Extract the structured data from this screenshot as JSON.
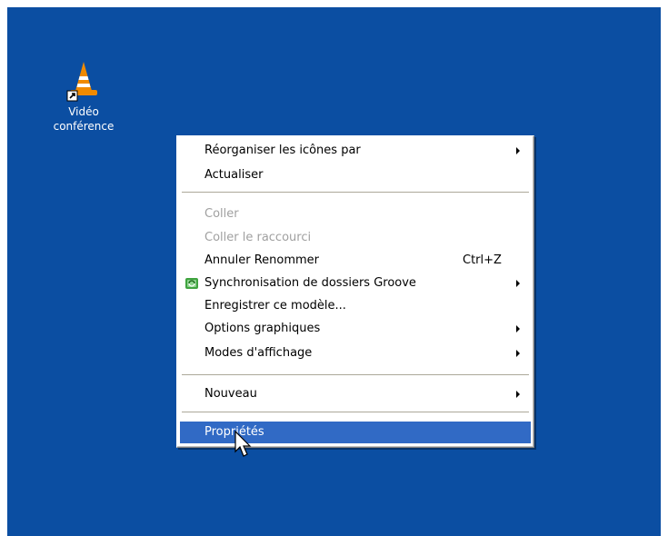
{
  "desktop": {
    "background": "#0b4ea2",
    "icon": {
      "name": "vlc-cone-icon",
      "label_line1": "Vidéo",
      "label_line2": "conférence"
    }
  },
  "context_menu": {
    "items": [
      {
        "label": "Réorganiser les icônes par",
        "submenu": true
      },
      {
        "label": "Actualiser"
      },
      {
        "separator": true
      },
      {
        "label": "Coller",
        "disabled": true
      },
      {
        "label": "Coller le raccourci",
        "disabled": true
      },
      {
        "label": "Annuler Renommer",
        "shortcut": "Ctrl+Z"
      },
      {
        "label": "Synchronisation de dossiers Groove",
        "submenu": true,
        "icon": "groove-sync-icon"
      },
      {
        "label": "Enregistrer ce modèle..."
      },
      {
        "label": "Options graphiques",
        "submenu": true
      },
      {
        "label": "Modes d'affichage",
        "submenu": true
      },
      {
        "separator": true
      },
      {
        "label": "Nouveau",
        "submenu": true
      },
      {
        "separator": true
      },
      {
        "label": "Propriétés",
        "highlighted": true
      }
    ],
    "highlight_color": "#316ac5"
  }
}
